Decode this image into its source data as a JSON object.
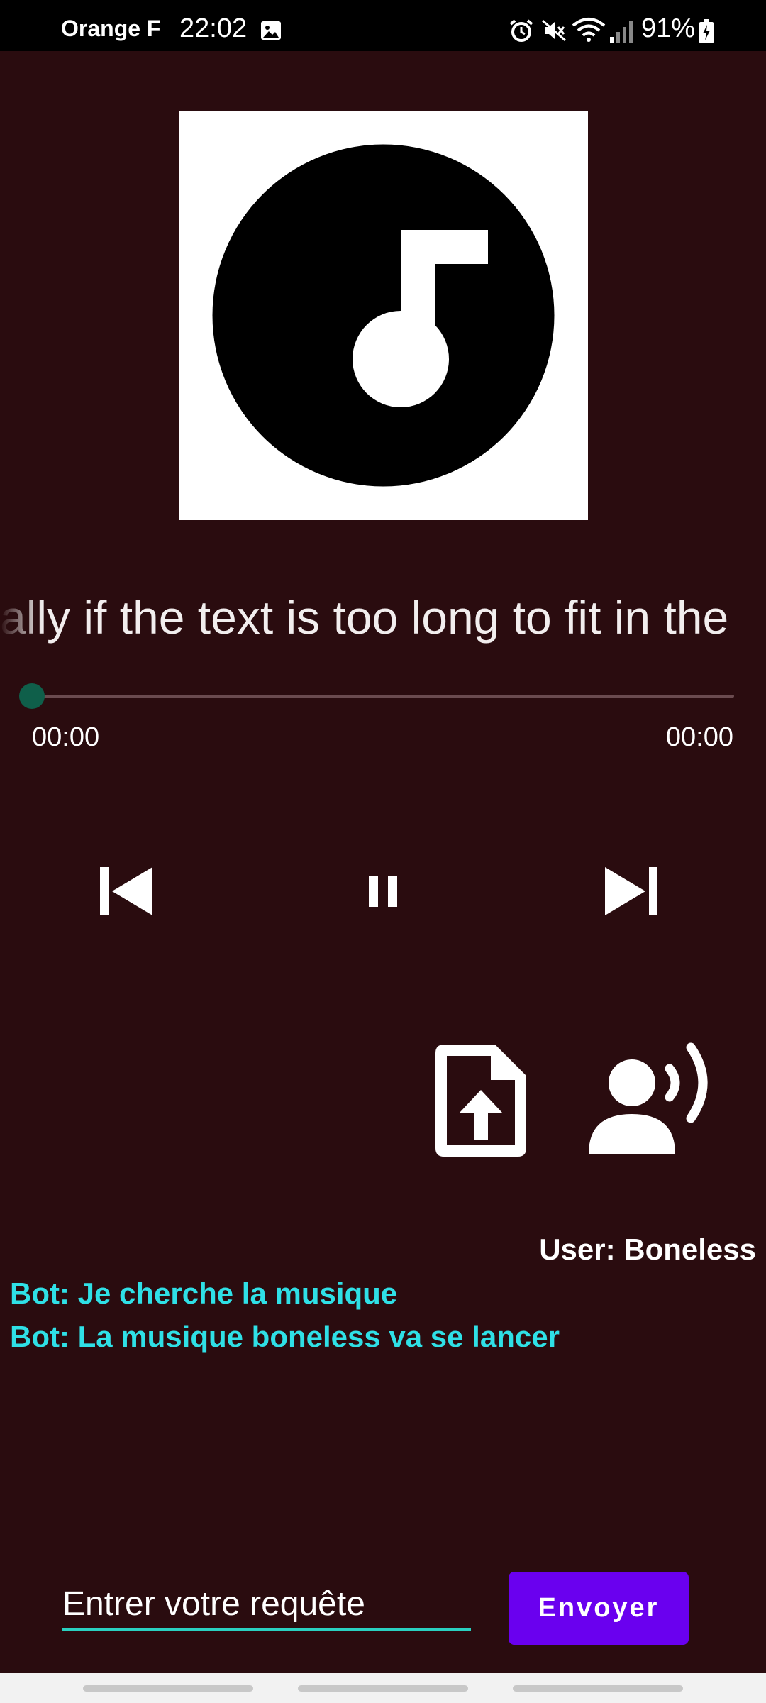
{
  "status_bar": {
    "carrier": "Orange F",
    "time": "22:02",
    "battery_percent": "91%",
    "icons": [
      "gallery-icon",
      "alarm-icon",
      "mute-icon",
      "wifi-icon",
      "signal-icon",
      "battery-charging-icon"
    ]
  },
  "player": {
    "album_art_icon": "music-note-icon",
    "title": "ally if the text is too long to fit in the",
    "progress": 0.0,
    "time_current": "00:00",
    "time_total": "00:00",
    "controls": {
      "previous_icon": "skip-previous-icon",
      "pause_icon": "pause-icon",
      "next_icon": "skip-next-icon"
    }
  },
  "actions": {
    "upload_icon": "file-upload-icon",
    "voice_icon": "voice-speaker-icon"
  },
  "chat": {
    "user_message": "User: Boneless",
    "bot_messages": [
      "Bot: Je cherche la musique",
      "Bot: La musique boneless va se lancer"
    ]
  },
  "input": {
    "placeholder": "Entrer votre requête",
    "value": ""
  },
  "send_button": {
    "label": "Envoyer"
  },
  "colors": {
    "background": "#2a0c0f",
    "accent_button": "#6a00ef",
    "bot_text": "#2fe0e6",
    "seek_thumb": "#0f5f4a",
    "input_underline": "#2ad0c0"
  }
}
